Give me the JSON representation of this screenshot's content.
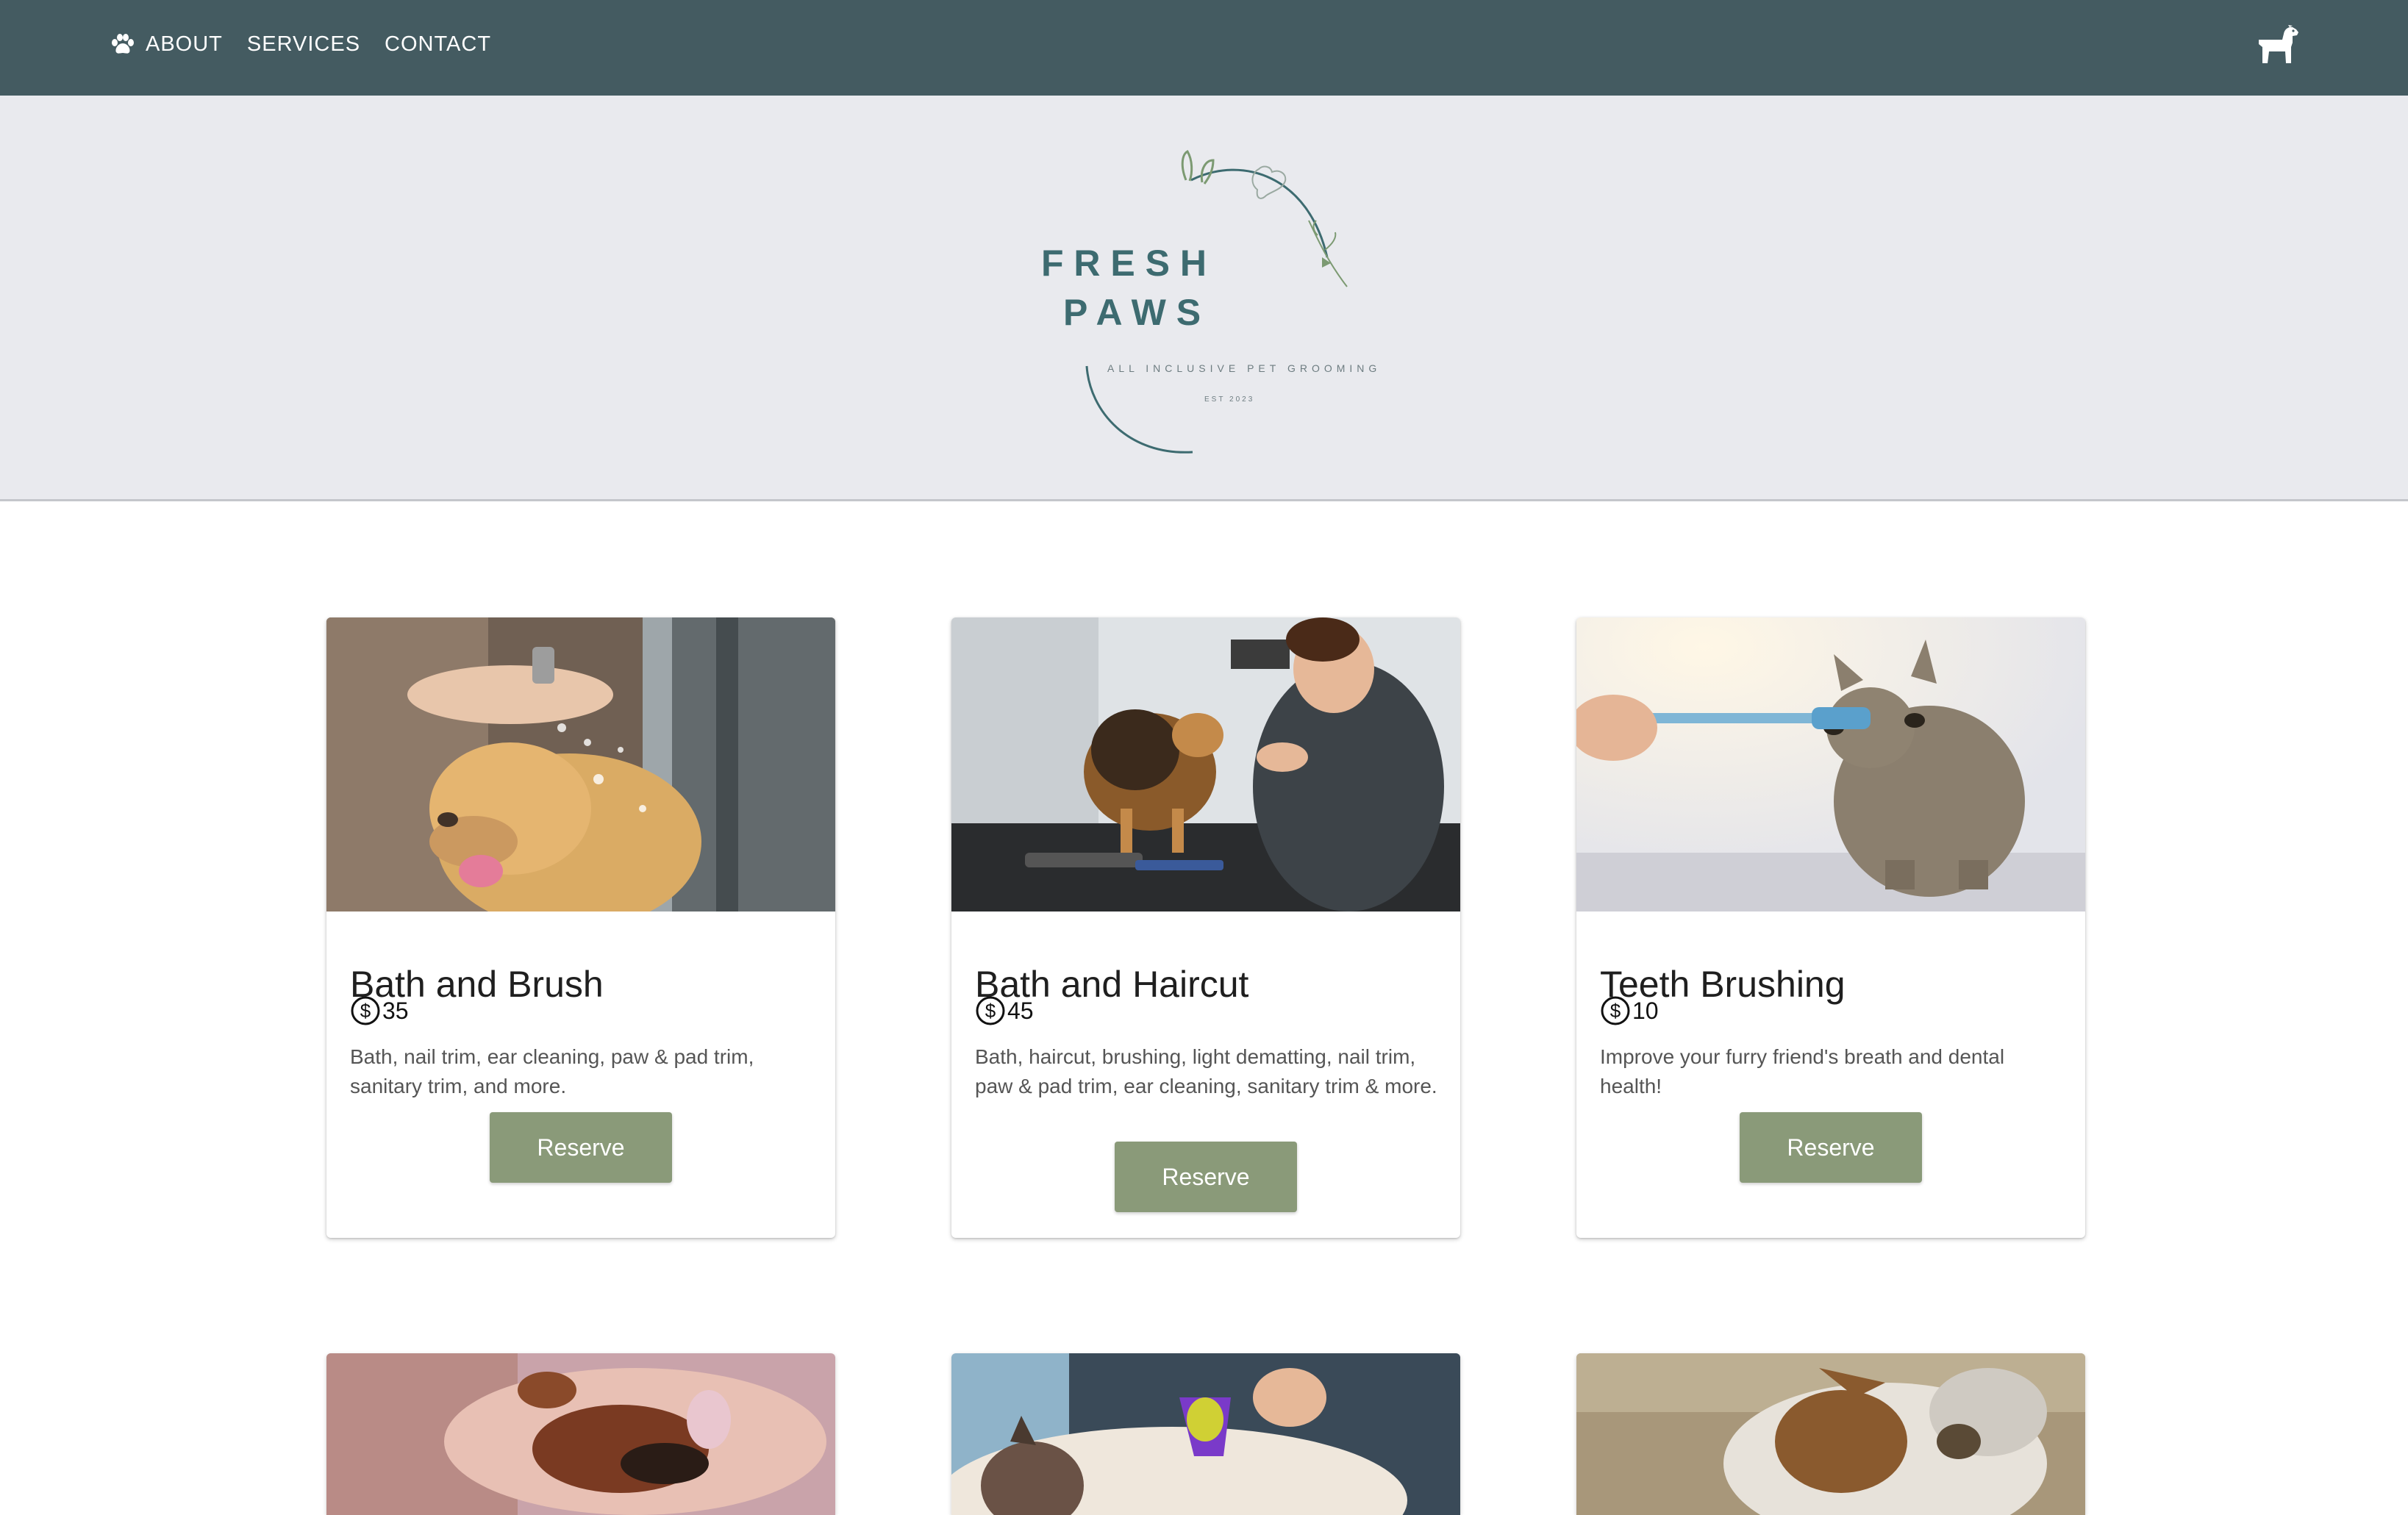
{
  "nav": {
    "links": [
      {
        "label": "ABOUT",
        "icon": "paw-icon"
      },
      {
        "label": "SERVICES"
      },
      {
        "label": "CONTACT"
      }
    ],
    "cart_icon": "dog-icon"
  },
  "logo": {
    "line1": "F R E S H",
    "line2": "P A W S",
    "tagline": "ALL INCLUSIVE PET GROOMING",
    "established": "EST 2023"
  },
  "colors": {
    "navbar": "#445b61",
    "hero_bg": "#e9eaee",
    "button": "#8a9a79",
    "logo_teal": "#3d6b70",
    "logo_sage": "#7c9a72"
  },
  "cards": [
    {
      "title": "Bath and Brush",
      "price": "35",
      "description": "Bath, nail trim, ear cleaning, paw & pad trim, sanitary trim, and more.",
      "button": "Reserve",
      "image": "golden retriever being bathed"
    },
    {
      "title": "Bath and Haircut",
      "price": "45",
      "description": "Bath, haircut, brushing, light dematting, nail trim, paw & pad trim, ear cleaning, sanitary trim & more.",
      "button": "Reserve",
      "image": "groomer with pomeranian"
    },
    {
      "title": "Teeth Brushing",
      "price": "10",
      "description": "Improve your furry friend's breath and dental health!",
      "button": "Reserve",
      "image": "cat with toothbrush"
    }
  ],
  "cards_row2": [
    {
      "image": "dog paw nail trim"
    },
    {
      "image": "cat being brushed with purple brush"
    },
    {
      "image": "terrier outdoors"
    }
  ]
}
